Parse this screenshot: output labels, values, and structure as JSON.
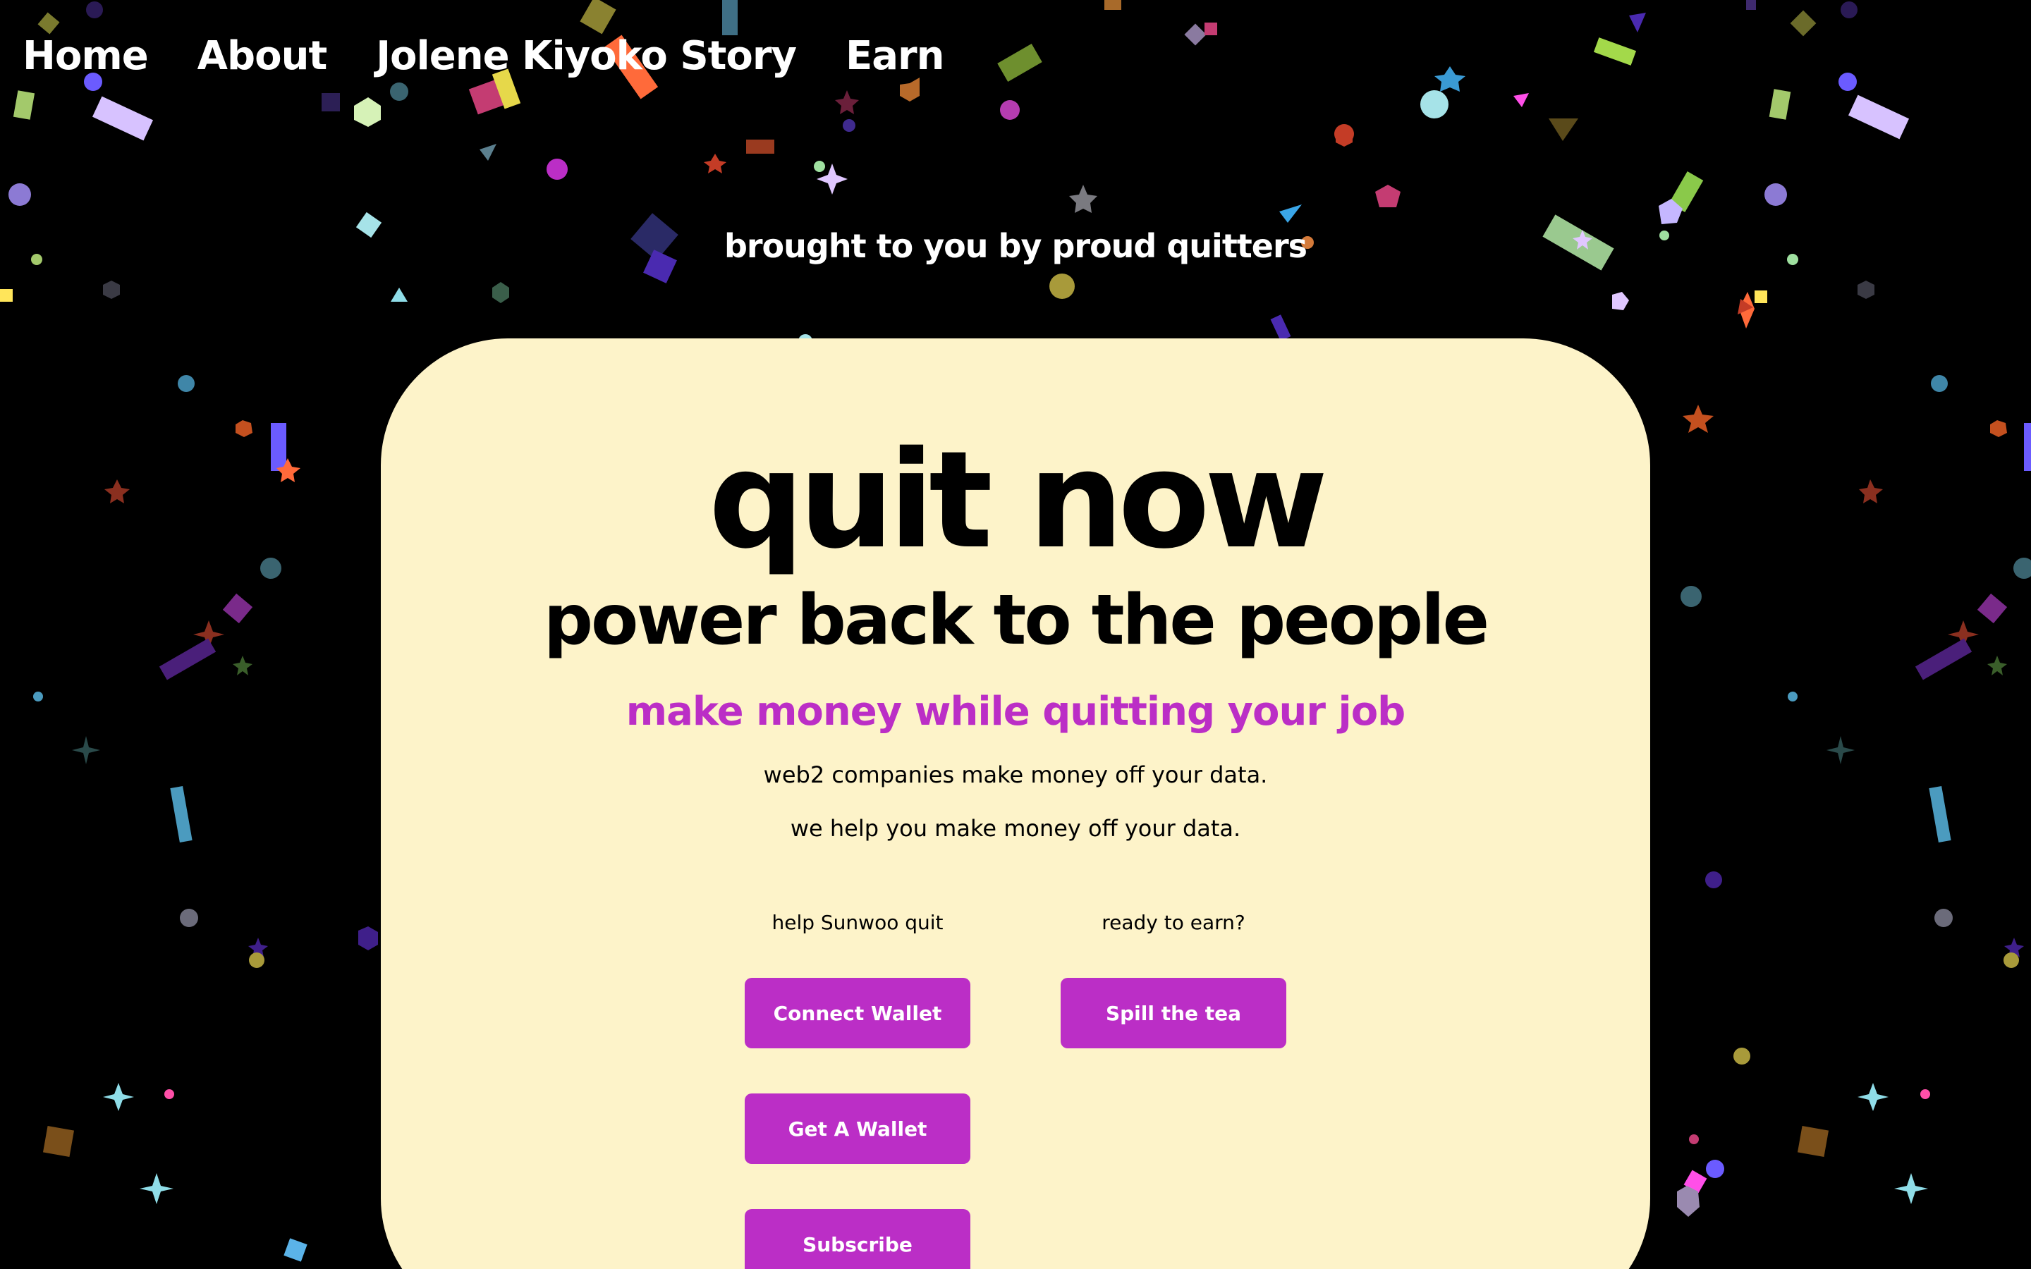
{
  "nav": {
    "items": [
      {
        "label": "Home"
      },
      {
        "label": "About"
      },
      {
        "label": "Jolene Kiyoko Story"
      },
      {
        "label": "Earn"
      }
    ]
  },
  "header": {
    "tagline": "brought to you by proud quitters"
  },
  "hero": {
    "title": "quit now",
    "subtitle": "power back to the people",
    "pitch": "make money while quitting your job",
    "body": [
      "web2 companies make money off your data.",
      "we help you make money off your data."
    ]
  },
  "actions": {
    "left_label": "help Sunwoo quit",
    "right_label": "ready to earn?",
    "connect_wallet": "Connect Wallet",
    "get_wallet": "Get A Wallet",
    "subscribe": "Subscribe",
    "spill_tea": "Spill the tea"
  },
  "colors": {
    "background": "#000000",
    "card": "#fdf3c9",
    "accent": "#bb2ec6",
    "nav_text": "#ffffff"
  },
  "decoration": {
    "confetti_palette": [
      "#6b6b2a",
      "#3f2a6e",
      "#6b5bff",
      "#a3c96b",
      "#e0c7ff",
      "#3a6470",
      "#c43c72",
      "#e6d84a",
      "#ff6a3a",
      "#3f86a8",
      "#b53cb0",
      "#9a3a1f",
      "#8c7ad4",
      "#ff4fa8",
      "#7a4f1a",
      "#ffe55a",
      "#4a3fa8",
      "#a6e3e8",
      "#9fe0a0",
      "#bb2ec6",
      "#4b9bbf"
    ]
  }
}
